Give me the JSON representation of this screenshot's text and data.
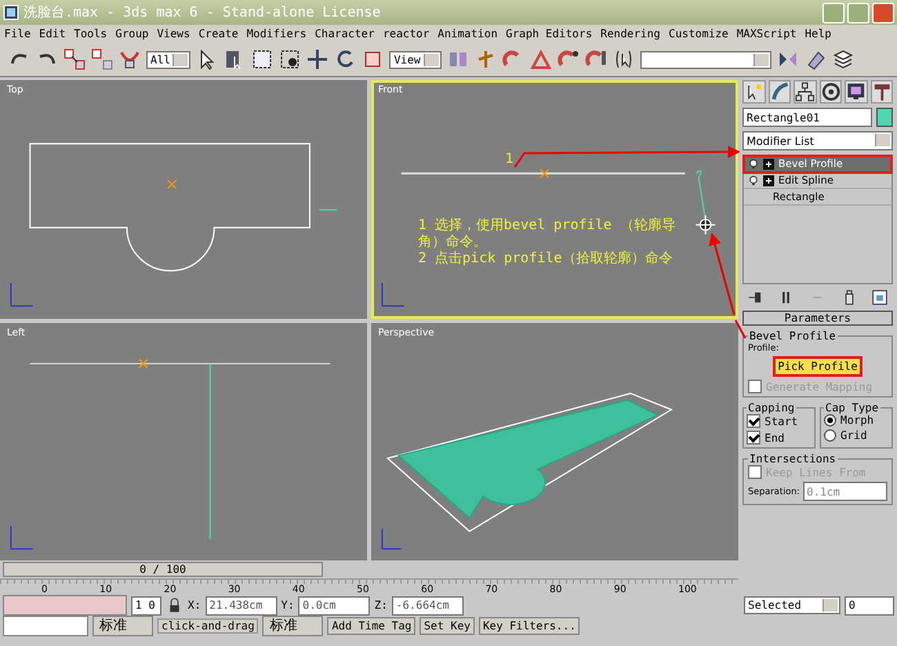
{
  "window": {
    "title": "洗脸台.max - 3ds max 6 - Stand-alone License"
  },
  "menu": [
    "File",
    "Edit",
    "Tools",
    "Group",
    "Views",
    "Create",
    "Modifiers",
    "Character",
    "reactor",
    "Animation",
    "Graph Editors",
    "Rendering",
    "Customize",
    "MAXScript",
    "Help"
  ],
  "toolbar": {
    "selection_filter": "All",
    "reference_coordinate": "View"
  },
  "viewports": [
    {
      "label": "Top",
      "active": false,
      "kind": "top"
    },
    {
      "label": "Front",
      "active": true,
      "kind": "front",
      "marker": "1",
      "notes": [
        "1 选择，使用bevel profile （轮廓导角）命令。",
        "2 点击pick profile（拾取轮廓）命令"
      ]
    },
    {
      "label": "Left",
      "active": false,
      "kind": "left"
    },
    {
      "label": "Perspective",
      "active": false,
      "kind": "perspective"
    }
  ],
  "command_panel": {
    "object_name": "Rectangle01",
    "modifier_list": "Modifier List",
    "stack": [
      {
        "label": "Bevel Profile",
        "kind": "modifier",
        "selected": true
      },
      {
        "label": "Edit Spline",
        "kind": "modifier",
        "selected": false
      },
      {
        "label": "Rectangle",
        "kind": "base",
        "selected": false
      }
    ],
    "rollout": "Parameters",
    "group": "Bevel Profile",
    "profile_label": "Profile:",
    "pick_button": "Pick Profile",
    "generate_mapping": {
      "label": "Generate Mapping",
      "checked": false,
      "disabled": true
    },
    "capping": {
      "title": "Capping",
      "items": [
        {
          "label": "Start",
          "checked": true
        },
        {
          "label": "End",
          "checked": true
        }
      ]
    },
    "cap_type": {
      "title": "Cap Type",
      "items": [
        {
          "label": "Morph",
          "selected": true
        },
        {
          "label": "Grid",
          "selected": false
        }
      ]
    },
    "intersections": {
      "title": "Intersections",
      "keep_lines": {
        "label": "Keep Lines From",
        "checked": false,
        "disabled": true
      },
      "separation_label": "Separation:",
      "separation": "0.1cm"
    }
  },
  "time_slider": {
    "frame": "0 / 100"
  },
  "ruler": [
    "0",
    "10",
    "20",
    "30",
    "40",
    "50",
    "60",
    "70",
    "80",
    "90",
    "100"
  ],
  "status": {
    "selection_count": "1 0",
    "x_label": "X:",
    "y_label": "Y:",
    "z_label": "Z:",
    "x": "21.438cm",
    "y": "0.0cm",
    "z": "-6.664cm",
    "prompt": "click-and-drag",
    "add_time_tag": "Add Time Tag",
    "set_key": "Set Key",
    "key_filters": "Key Filters...",
    "key_mode": "Selected",
    "frame_field": "0"
  },
  "ime_bars": [
    {
      "label": "标准"
    },
    {
      "label": "标准"
    }
  ]
}
